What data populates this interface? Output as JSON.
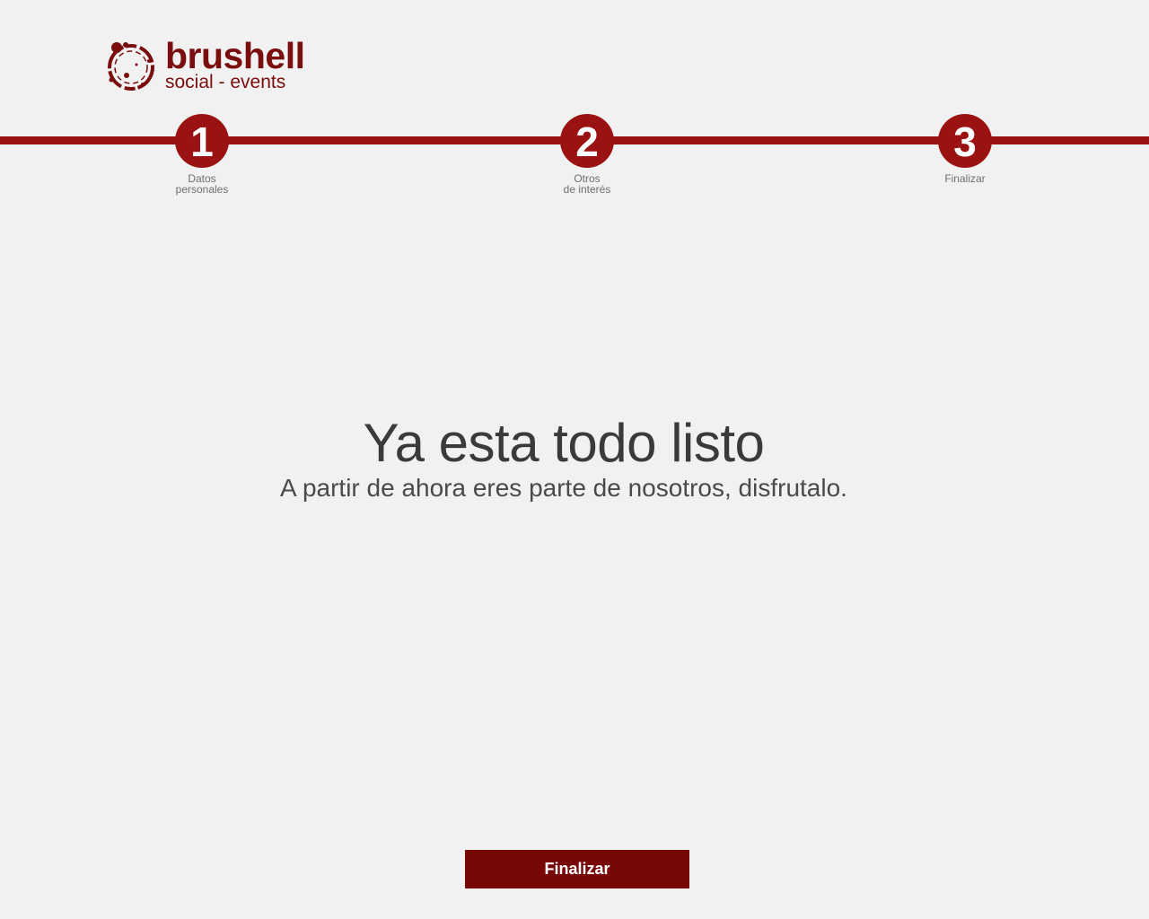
{
  "brand": {
    "name": "brushell",
    "tagline": "social - events",
    "color": "#7a0d0d"
  },
  "stepper": {
    "color": "#9b1212",
    "current_step": 3,
    "steps": [
      {
        "number": "1",
        "label_line1": "Datos",
        "label_line2": "personales"
      },
      {
        "number": "2",
        "label_line1": "Otros",
        "label_line2": "de interés"
      },
      {
        "number": "3",
        "label_line1": "Finalizar",
        "label_line2": ""
      }
    ]
  },
  "message": {
    "title": "Ya esta todo listo",
    "subtitle": "A partir de ahora eres parte de nosotros, disfrutalo."
  },
  "actions": {
    "finish_label": "Finalizar",
    "finish_color": "#780808"
  },
  "icons": {
    "logo": "splash-circle-logo-icon"
  }
}
